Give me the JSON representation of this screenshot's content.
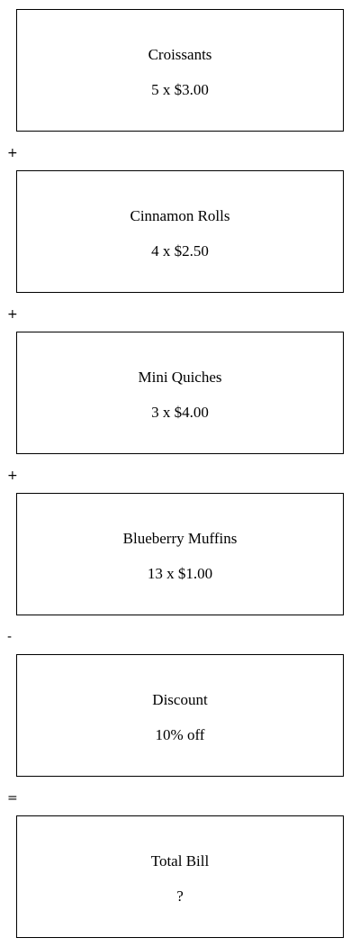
{
  "items": [
    {
      "name": "Croissants",
      "detail": "5 x $3.00"
    },
    {
      "name": "Cinnamon Rolls",
      "detail": "4 x $2.50"
    },
    {
      "name": "Mini Quiches",
      "detail": "3 x $4.00"
    },
    {
      "name": "Blueberry Muffins",
      "detail": "13 x $1.00"
    },
    {
      "name": "Discount",
      "detail": "10% off"
    },
    {
      "name": "Total Bill",
      "detail": "?"
    }
  ],
  "operators": [
    "+",
    "+",
    "+",
    "-",
    "="
  ]
}
